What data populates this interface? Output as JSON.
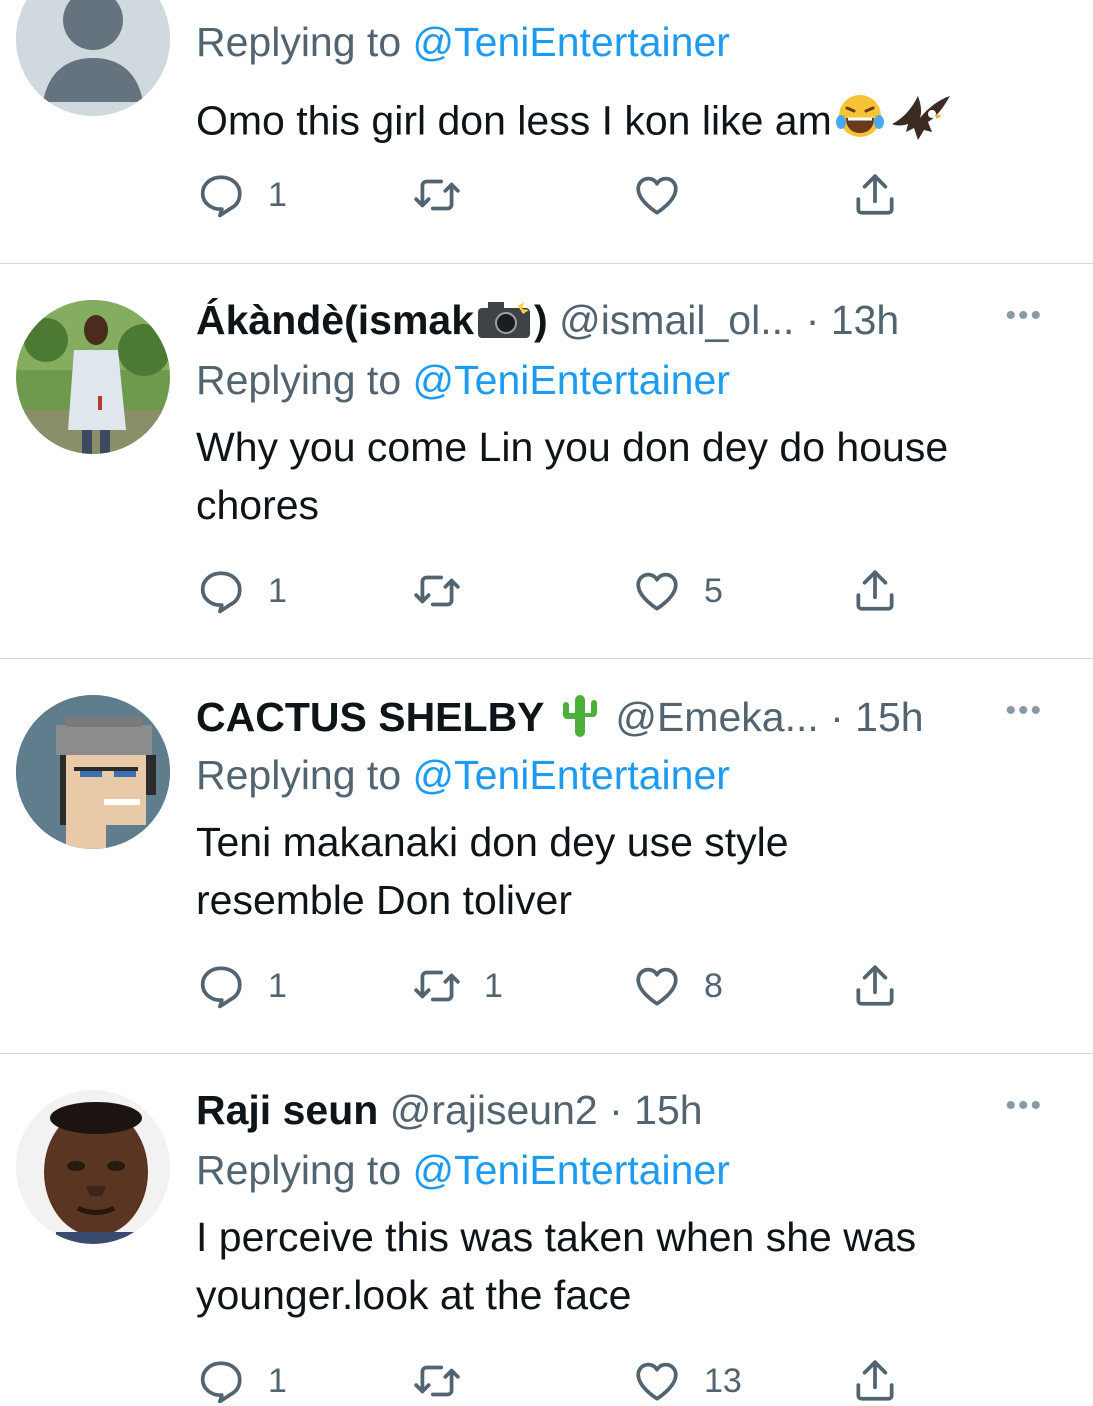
{
  "tweets": [
    {
      "name": "",
      "handle": "",
      "time": "",
      "replying_prefix": "Replying to ",
      "replying_to": "@TeniEntertainer",
      "text": "Omo this girl don less I kon like am",
      "emoji": [
        "laughing-emoji",
        "eagle-emoji"
      ],
      "replies": "1",
      "retweets": "",
      "likes": "",
      "avatar": "default-avatar-icon"
    },
    {
      "name": "Ákàndè(ismak",
      "name_suffix": ")",
      "name_emoji": "camera-flash-emoji",
      "handle": "@ismail_ol...",
      "time": " · 13h",
      "replying_prefix": "Replying to ",
      "replying_to": "@TeniEntertainer",
      "text": "Why you come Lin you don dey do house chores",
      "replies": "1",
      "retweets": "",
      "likes": "5",
      "avatar": "photo-avatar"
    },
    {
      "name": "CACTUS SHELBY",
      "name_emoji": "cactus-emoji",
      "handle": "@Emeka...",
      "time": " · 15h",
      "replying_prefix": "Replying to ",
      "replying_to": "@TeniEntertainer",
      "text": "Teni makanaki don dey use style resemble Don toliver",
      "replies": "1",
      "retweets": "1",
      "likes": "8",
      "avatar": "pixel-art-avatar"
    },
    {
      "name": "Raji seun",
      "handle": "@rajiseun2",
      "time": " · 15h",
      "replying_prefix": "Replying to ",
      "replying_to": "@TeniEntertainer",
      "text": "I perceive this was taken when she was younger.look at the face",
      "replies": "1",
      "retweets": "",
      "likes": "13",
      "avatar": "photo-avatar"
    }
  ],
  "more_glyph": "•••",
  "colors": {
    "link": "#1d9bf0",
    "secondary": "#536471",
    "divider": "#d3d8dc"
  }
}
